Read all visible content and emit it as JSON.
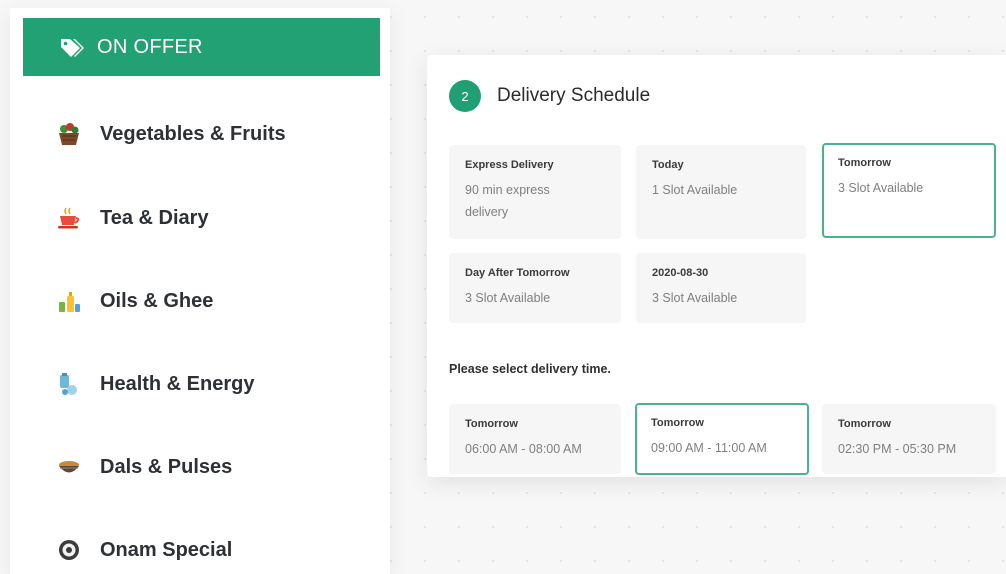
{
  "categories": {
    "offer_label": "ON OFFER",
    "items": [
      {
        "label": "Vegetables & Fruits",
        "icon": "vegetable-basket-icon"
      },
      {
        "label": "Tea & Diary",
        "icon": "tea-cup-icon"
      },
      {
        "label": "Oils & Ghee",
        "icon": "oil-bottles-icon"
      },
      {
        "label": "Health & Energy",
        "icon": "health-energy-icon"
      },
      {
        "label": "Dals & Pulses",
        "icon": "pulses-bowl-icon"
      },
      {
        "label": "Onam Special",
        "icon": "onam-special-icon"
      }
    ]
  },
  "delivery": {
    "step": "2",
    "title": "Delivery Schedule",
    "day_options": [
      {
        "title": "Express Delivery",
        "detail": "90 min express delivery",
        "selected": false
      },
      {
        "title": "Today",
        "detail": "1 Slot Available",
        "selected": false
      },
      {
        "title": "Tomorrow",
        "detail": "3 Slot Available",
        "selected": true
      },
      {
        "title": "Day After Tomorrow",
        "detail": "3 Slot Available",
        "selected": false
      },
      {
        "title": "2020-08-30",
        "detail": "3 Slot Available",
        "selected": false
      }
    ],
    "time_prompt": "Please select delivery time.",
    "time_slots": [
      {
        "day": "Tomorrow",
        "range": "06:00 AM - 08:00 AM",
        "selected": false
      },
      {
        "day": "Tomorrow",
        "range": "09:00 AM - 11:00 AM",
        "selected": true
      },
      {
        "day": "Tomorrow",
        "range": "02:30 PM - 05:30 PM",
        "selected": false
      }
    ]
  },
  "colors": {
    "brand_green": "#21a174",
    "selected_border": "#4bb28a"
  }
}
